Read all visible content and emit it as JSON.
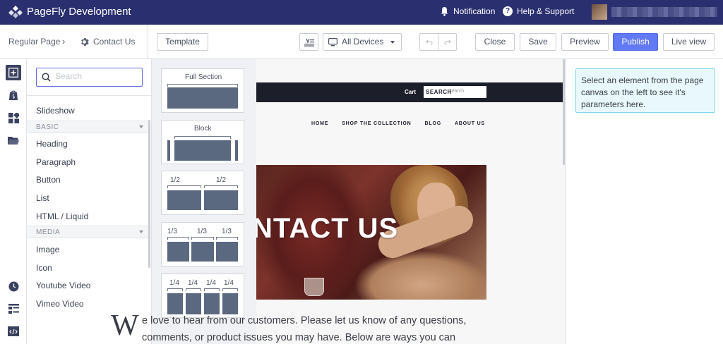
{
  "app": {
    "title": "PageFly Development"
  },
  "topbar": {
    "notification": "Notification",
    "help": "Help & Support",
    "help_icon": "?"
  },
  "toolbar": {
    "breadcrumb_root": "Regular Page",
    "breadcrumb_sep": "›",
    "breadcrumb_page": "Contact Us",
    "template": "Template",
    "device": "All Devices",
    "close": "Close",
    "save": "Save",
    "preview": "Preview",
    "publish": "Publish",
    "live_view": "Live view"
  },
  "elements": {
    "search_placeholder": "Search",
    "slideshow": "Slideshow",
    "cat_basic": "BASIC",
    "basic": [
      "Heading",
      "Paragraph",
      "Button",
      "List",
      "HTML / Liquid"
    ],
    "cat_media": "MEDIA",
    "media": [
      "Image",
      "Icon",
      "Youtube Video",
      "Vimeo Video"
    ]
  },
  "layouts": {
    "full_section": "Full Section",
    "block": "Block",
    "half": "1/2",
    "third": "1/3",
    "quarter": "1/4"
  },
  "canvas": {
    "cart": "Cart",
    "search_label": "SEARCH",
    "search_placeholder": "Search",
    "nav": [
      "HOME",
      "SHOP THE COLLECTION",
      "BLOG",
      "ABOUT US"
    ],
    "hero_title": "NTACT US",
    "intro_cap": "W",
    "intro_line1": "e love to hear from our customers. Please let us know of any questions,",
    "intro_line2": "comments, or product issues you may have. Below are ways you can"
  },
  "right_panel": {
    "hint": "Select an element from the page canvas on the left to see it's parameters here."
  },
  "colors": {
    "topbar": "#2a2f6f",
    "publish": "#6279f5",
    "hint_bg": "#e9f8fc",
    "hint_border": "#7fd6ec",
    "layout_block": "#5a6880"
  }
}
